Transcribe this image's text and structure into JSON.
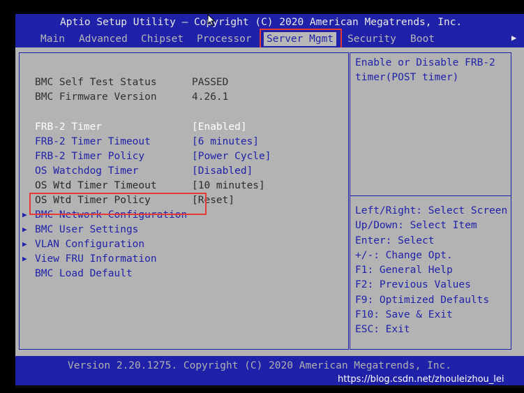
{
  "header": {
    "title": "Aptio Setup Utility – Copyright (C) 2020 American Megatrends, Inc.",
    "tabs": [
      {
        "label": "Main"
      },
      {
        "label": "Advanced"
      },
      {
        "label": "Chipset"
      },
      {
        "label": "Processor"
      },
      {
        "label": "Server Mgmt"
      },
      {
        "label": "Security"
      },
      {
        "label": "Boot"
      }
    ],
    "active_tab": "Server Mgmt",
    "more_tabs_icon": "right-arrow-icon"
  },
  "settings": {
    "bmc_self_test": {
      "label": "BMC Self Test Status",
      "value": "PASSED"
    },
    "bmc_firmware": {
      "label": "BMC Firmware Version",
      "value": "4.26.1"
    },
    "frb2_timer": {
      "label": "FRB-2 Timer",
      "value": "[Enabled]"
    },
    "frb2_timeout": {
      "label": "FRB-2 Timer Timeout",
      "value": "[6 minutes]"
    },
    "frb2_policy": {
      "label": "FRB-2 Timer Policy",
      "value": "[Power Cycle]"
    },
    "os_watchdog": {
      "label": "OS Watchdog Timer",
      "value": "[Disabled]"
    },
    "os_wtd_timeout": {
      "label": "OS Wtd Timer Timeout",
      "value": "[10 minutes]"
    },
    "os_wtd_policy": {
      "label": "OS Wtd Timer Policy",
      "value": "[Reset]"
    }
  },
  "submenus": [
    {
      "label": "BMC Network Configuration"
    },
    {
      "label": "BMC User Settings"
    },
    {
      "label": "VLAN Configuration"
    },
    {
      "label": "View FRU Information"
    }
  ],
  "bmc_load_default": "BMC Load Default",
  "help": {
    "text": "Enable or Disable FRB-2\ntimer(POST timer)",
    "keys": [
      "Left/Right: Select Screen",
      "Up/Down: Select Item",
      "Enter: Select",
      "+/-: Change Opt.",
      "F1: General Help",
      "F2: Previous Values",
      "F9: Optimized Defaults",
      "F10: Save & Exit",
      "ESC: Exit"
    ]
  },
  "footer": {
    "version": "Version 2.20.1275. Copyright (C) 2020 American Megatrends, Inc."
  },
  "watermark": "https://blog.csdn.net/zhouleizhou_lei",
  "colors": {
    "bios_blue": "#1f22a8",
    "panel_grey": "#b3b3b3",
    "highlight_red": "#e53935"
  }
}
